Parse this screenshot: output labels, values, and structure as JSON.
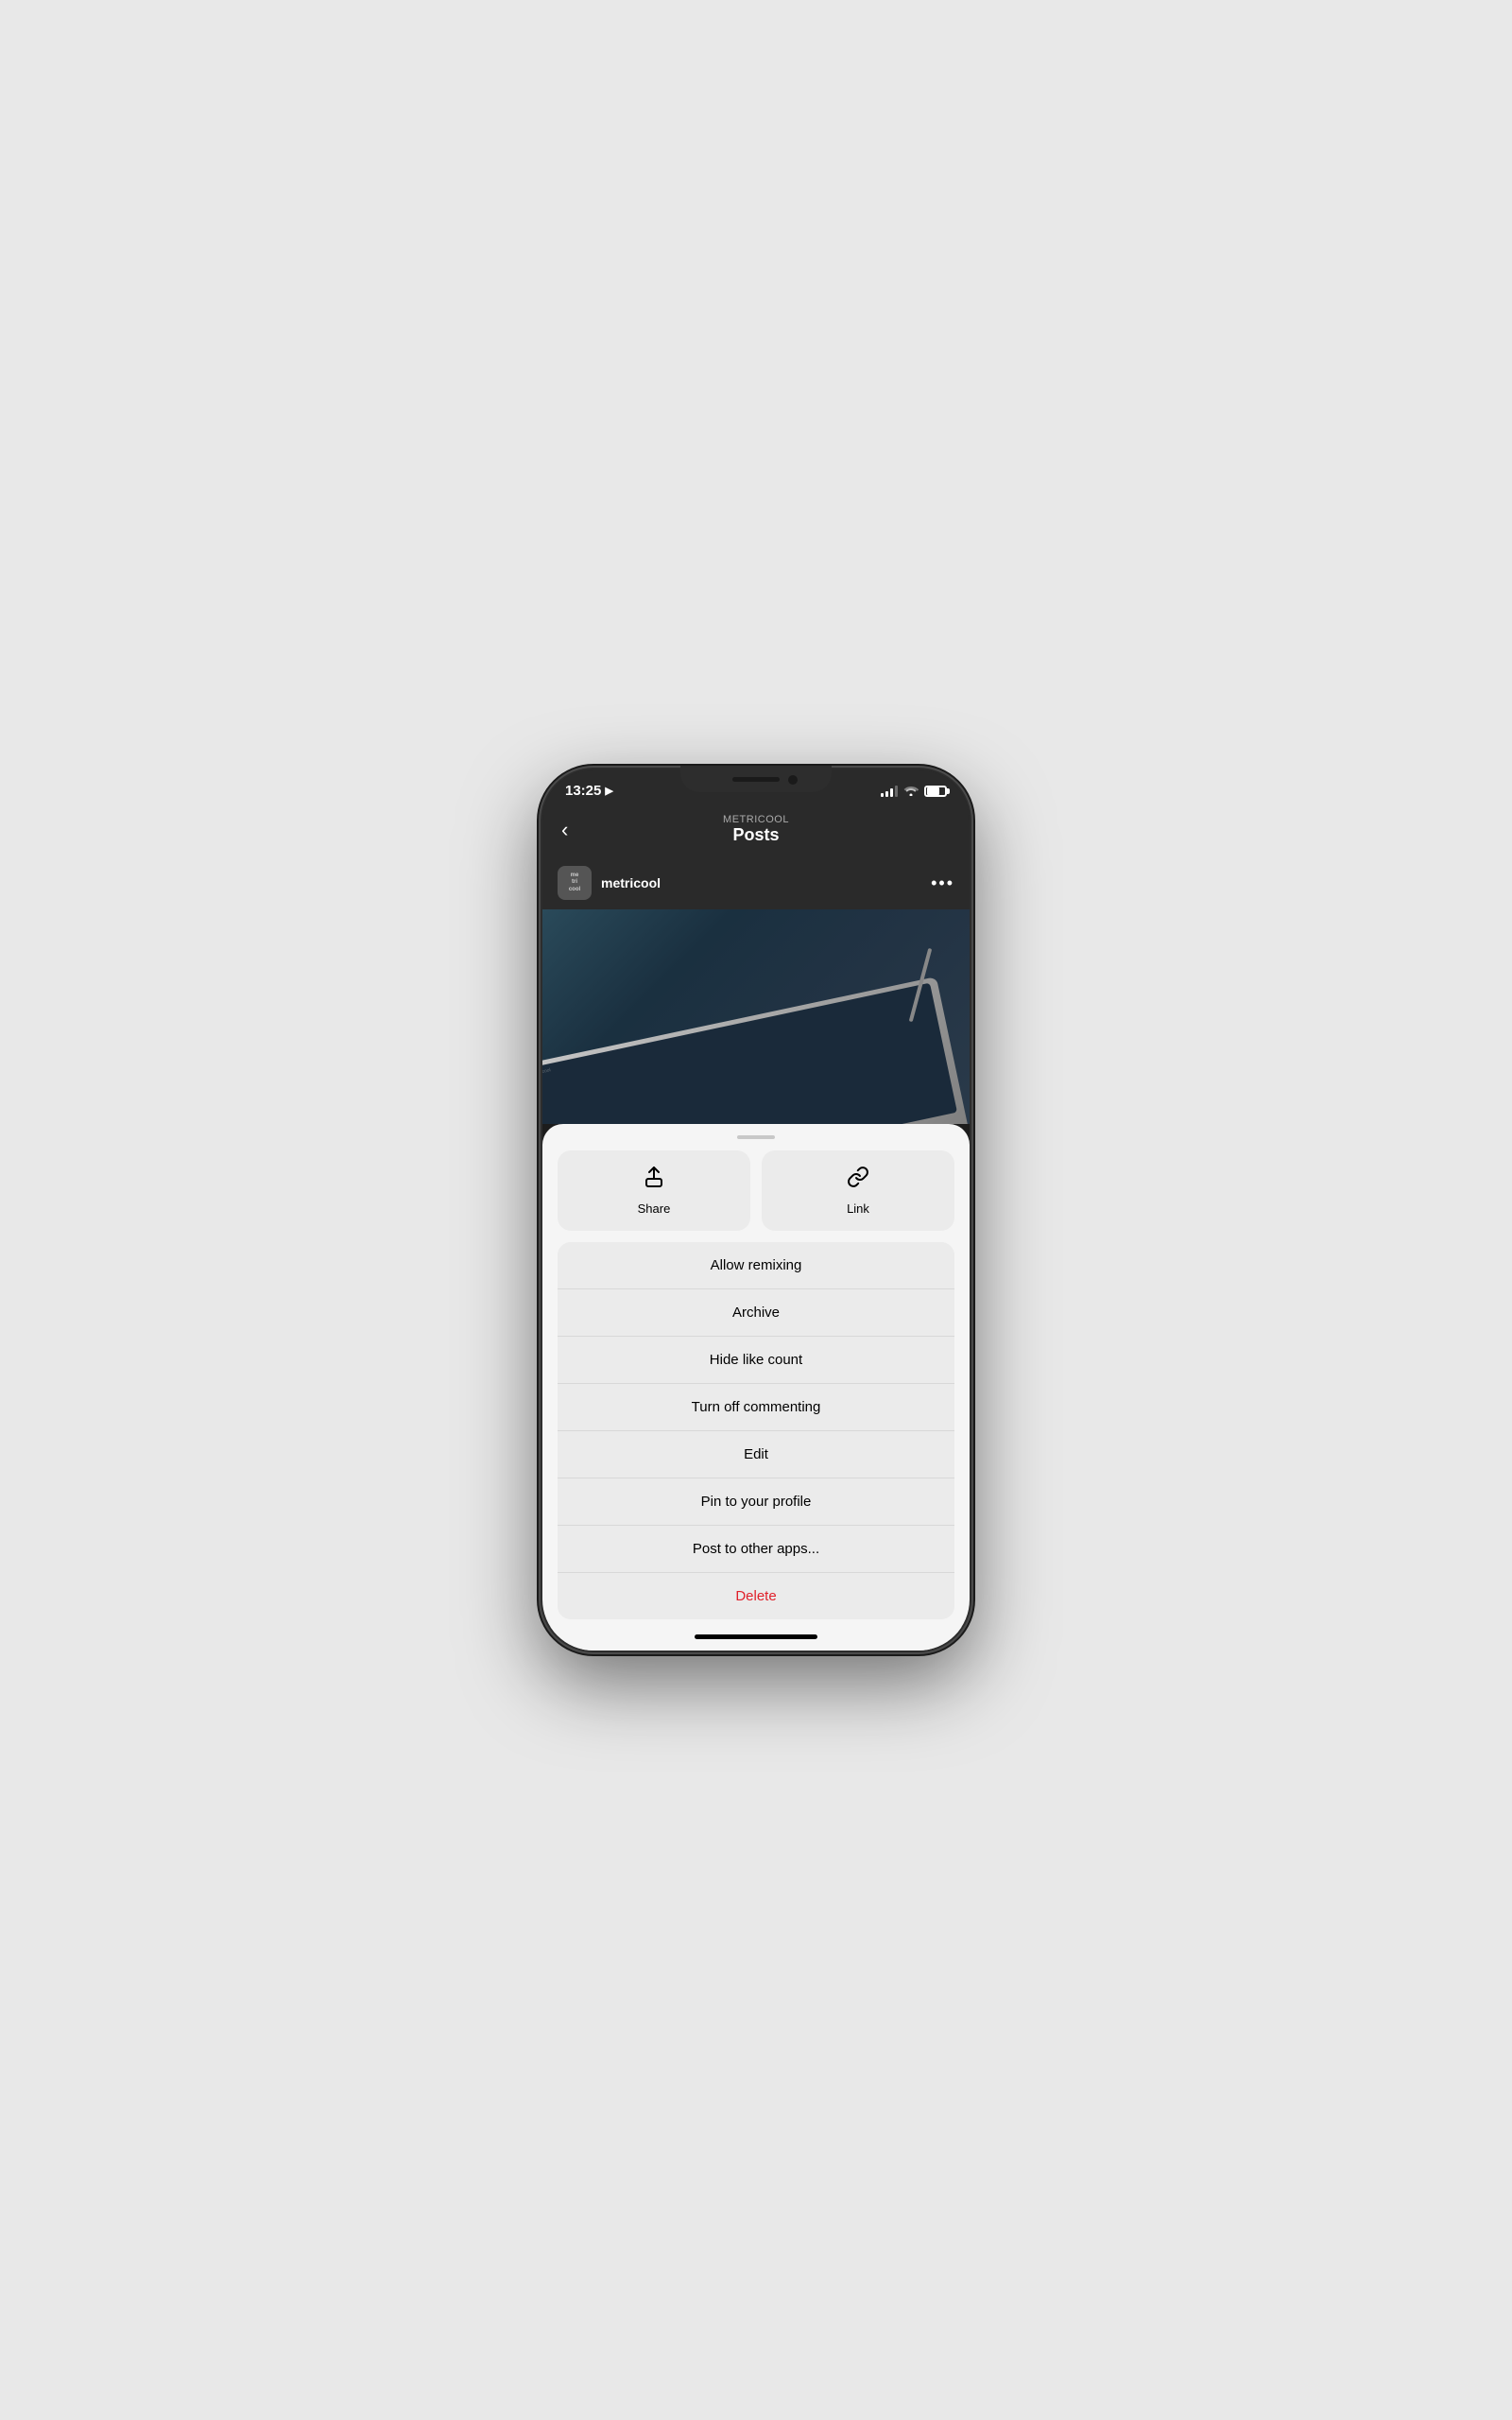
{
  "status_bar": {
    "time": "13:25",
    "location_icon": "▶",
    "signal_bars": [
      3,
      5,
      7,
      9
    ],
    "battery_level": 65
  },
  "nav": {
    "back_label": "‹",
    "subtitle": "METRICOOL",
    "title": "Posts"
  },
  "post": {
    "username": "metricool",
    "avatar_text": "me\ntri\ncool",
    "more_options_label": "•••"
  },
  "sheet": {
    "handle_aria": "drag handle",
    "action_buttons": [
      {
        "id": "share",
        "label": "Share"
      },
      {
        "id": "link",
        "label": "Link"
      }
    ],
    "menu_items": [
      {
        "id": "allow-remixing",
        "label": "Allow remixing",
        "style": "normal"
      },
      {
        "id": "archive",
        "label": "Archive",
        "style": "normal"
      },
      {
        "id": "hide-like-count",
        "label": "Hide like count",
        "style": "normal"
      },
      {
        "id": "turn-off-commenting",
        "label": "Turn off commenting",
        "style": "normal"
      },
      {
        "id": "edit",
        "label": "Edit",
        "style": "normal"
      },
      {
        "id": "pin-to-profile",
        "label": "Pin to your profile",
        "style": "normal"
      },
      {
        "id": "post-to-other-apps",
        "label": "Post to other apps...",
        "style": "normal"
      },
      {
        "id": "delete",
        "label": "Delete",
        "style": "delete"
      }
    ]
  },
  "home_indicator": {
    "aria": "home bar"
  }
}
